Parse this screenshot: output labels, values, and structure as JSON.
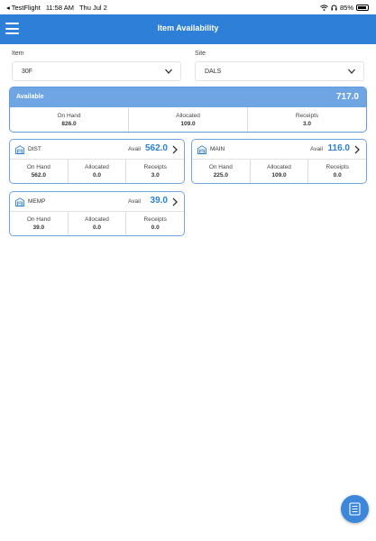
{
  "status_bar": {
    "app": "◂ TestFlight",
    "time": "11:58 AM",
    "date": "Thu Jul 2",
    "battery": "85%"
  },
  "header": {
    "title": "Item Availability"
  },
  "item": {
    "label": "Item",
    "value": "30F"
  },
  "site": {
    "label": "Site",
    "value": "DALS"
  },
  "available": {
    "label": "Available",
    "value": "717.0",
    "on_hand_label": "On Hand",
    "on_hand": "826.0",
    "allocated_label": "Allocated",
    "allocated": "109.0",
    "receipts_label": "Receipts",
    "receipts": "3.0"
  },
  "sites": [
    {
      "name": "DIST",
      "avail_label": "Avail",
      "avail": "562.0",
      "on_hand_label": "On Hand",
      "on_hand": "562.0",
      "allocated_label": "Allocated",
      "allocated": "0.0",
      "receipts_label": "Receipts",
      "receipts": "3.0"
    },
    {
      "name": "MAIN",
      "avail_label": "Avail",
      "avail": "116.0",
      "on_hand_label": "On Hand",
      "on_hand": "225.0",
      "allocated_label": "Allocated",
      "allocated": "109.0",
      "receipts_label": "Receipts",
      "receipts": "0.0"
    },
    {
      "name": "MEMP",
      "avail_label": "Avail",
      "avail": "39.0",
      "on_hand_label": "On Hand",
      "on_hand": "39.0",
      "allocated_label": "Allocated",
      "allocated": "0.0",
      "receipts_label": "Receipts",
      "receipts": "0.0"
    }
  ],
  "colors": {
    "header": "#2d7fd8",
    "summary_head": "#6fa5e3",
    "accent": "#2d7fd8"
  },
  "icons": {
    "menu": "hamburger-icon",
    "warehouse": "warehouse-icon",
    "fab": "document-icon"
  }
}
